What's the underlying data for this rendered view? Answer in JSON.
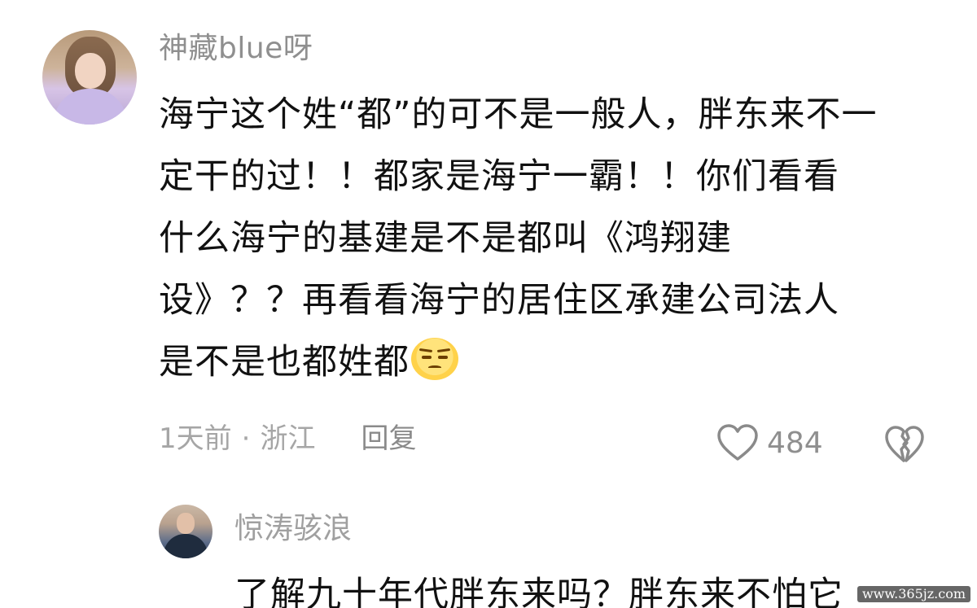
{
  "comments": [
    {
      "username": "神藏blue呀",
      "lines": [
        "海宁这个姓“都”的可不是一般人，胖东来不一",
        "定干的过！！都家是海宁一霸！！你们看看",
        "什么海宁的基建是不是都叫《鸿翔建",
        "设》？？再看看海宁的居住区承建公司法人",
        "是不是也都姓都"
      ],
      "emoji": "smirk-face-emoji",
      "time": "1天前",
      "separator": "·",
      "location": "浙江",
      "reply_label": "回复",
      "likes": "484"
    },
    {
      "username": "惊涛骇浪",
      "text": "了解九十年代胖东来吗？胖东来不怕它"
    }
  ],
  "watermark": "www.365jz.com",
  "icons": {
    "like": "heart-outline-icon",
    "dislike": "broken-heart-icon"
  },
  "colors": {
    "text_primary": "#111111",
    "text_secondary": "#8f8f8f",
    "icon": "#8a8a8a"
  }
}
